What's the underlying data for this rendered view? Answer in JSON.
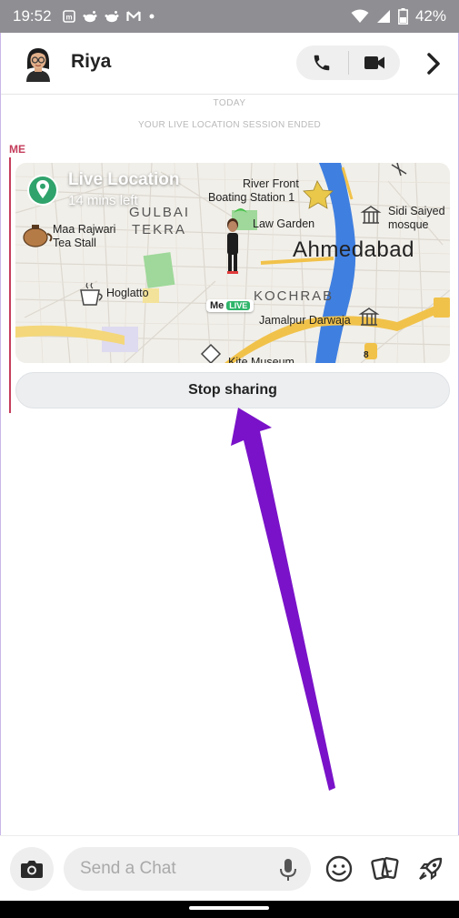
{
  "status_bar": {
    "time": "19:52",
    "battery_percent": "42%",
    "notification_icons": [
      "m-box-icon",
      "reddit-icon",
      "reddit-icon",
      "gmail-icon",
      "dot-icon"
    ]
  },
  "header": {
    "contact_name": "Riya",
    "icons": [
      "bitmoji-avatar",
      "phone-icon",
      "video-icon",
      "chevron-right-icon"
    ]
  },
  "chat": {
    "day_label": "TODAY",
    "session_notice": "YOUR LIVE LOCATION SESSION ENDED",
    "sender_label": "ME",
    "live_location": {
      "title": "Live Location",
      "subtitle": "14 mins left",
      "me_label": "Me",
      "live_badge": "LIVE",
      "map_labels": {
        "gulbai": "GULBAI",
        "tekra": "TEKRA",
        "river_front_1": "River Front",
        "river_front_2": "Boating Station 1",
        "sidi_1": "Sidi Saiyed",
        "sidi_2": "mosque",
        "maa_rajwari_1": "Maa Rajwari",
        "maa_rajwari_2": "Tea Stall",
        "law_garden": "Law Garden",
        "ahmedabad": "Ahmedabad",
        "hoglatto": "Hoglatto",
        "kochrab": "KOCHRAB",
        "jamalpur": "Jamalpur Darwaja",
        "kite_museum": "Kite Museum",
        "road_number": "8"
      }
    },
    "stop_button_label": "Stop sharing"
  },
  "composer": {
    "placeholder": "Send a Chat",
    "value": ""
  },
  "colors": {
    "accent_red": "#c43d5b",
    "arrow_purple": "#7a12c9",
    "river_blue": "#3f7fe0",
    "live_green": "#2fb56a"
  }
}
